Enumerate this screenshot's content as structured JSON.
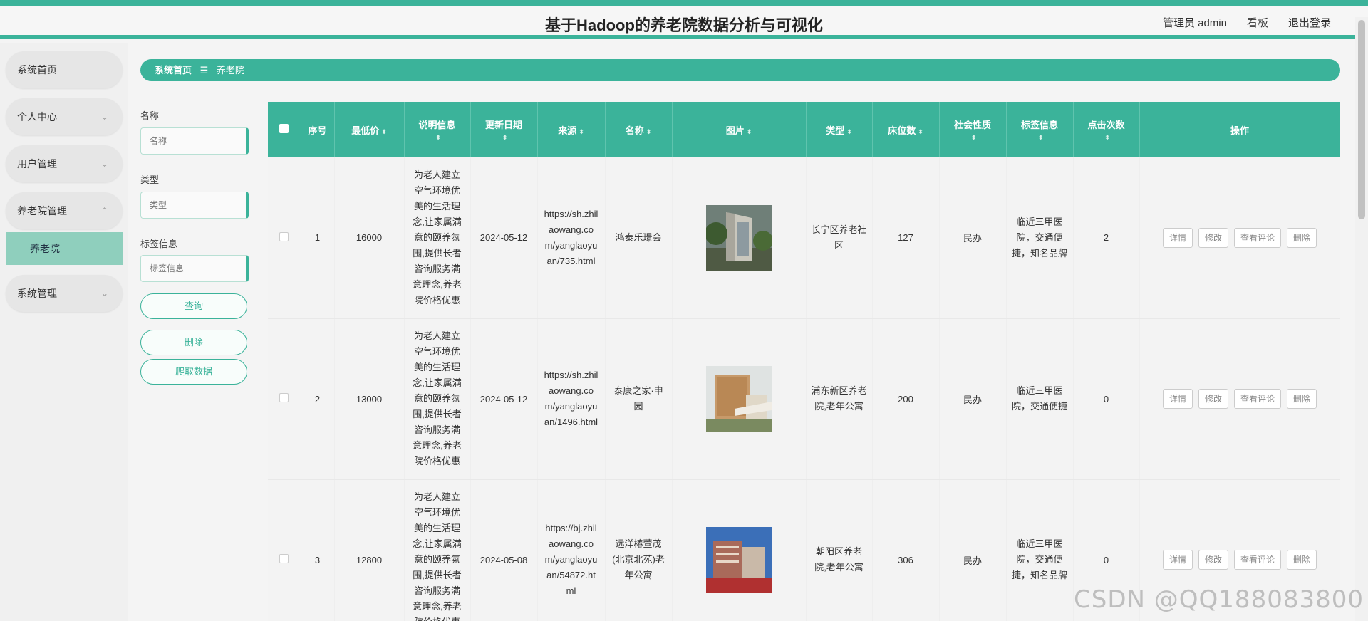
{
  "header": {
    "title": "基于Hadoop的养老院数据分析与可视化",
    "admin": "管理员 admin",
    "board": "看板",
    "logout": "退出登录"
  },
  "sidebar": {
    "items": [
      {
        "label": "系统首页"
      },
      {
        "label": "个人中心"
      },
      {
        "label": "用户管理"
      },
      {
        "label": "养老院管理"
      },
      {
        "label": "养老院"
      },
      {
        "label": "系统管理"
      }
    ]
  },
  "breadcrumb": {
    "home": "系统首页",
    "separator": "☰",
    "current": "养老院"
  },
  "filters": {
    "name_label": "名称",
    "name_placeholder": "名称",
    "type_label": "类型",
    "type_placeholder": "类型",
    "tag_label": "标签信息",
    "tag_placeholder": "标签信息",
    "query_button": "查询",
    "delete_button": "删除",
    "crawl_button": "爬取数据"
  },
  "table": {
    "columns": [
      "序号",
      "最低价",
      "说明信息",
      "更新日期",
      "来源",
      "名称",
      "图片",
      "类型",
      "床位数",
      "社会性质",
      "标签信息",
      "点击次数",
      "操作"
    ],
    "actions": [
      "详情",
      "修改",
      "查看评论",
      "删除"
    ],
    "rows": [
      {
        "index": "1",
        "price": "16000",
        "desc": "为老人建立空气环境优美的生活理念,让家属满意的颐养氛围,提供长者咨询服务满意理念,养老院价格优惠",
        "date": "2024-05-12",
        "source": "https://sh.zhilaowang.com/yanglaoyuan/735.html",
        "name": "鸿泰乐璟会",
        "type": "长宁区养老社区",
        "beds": "127",
        "nature": "民办",
        "tags": "临近三甲医院，交通便捷，知名品牌",
        "clicks": "2"
      },
      {
        "index": "2",
        "price": "13000",
        "desc": "为老人建立空气环境优美的生活理念,让家属满意的颐养氛围,提供长者咨询服务满意理念,养老院价格优惠",
        "date": "2024-05-12",
        "source": "https://sh.zhilaowang.com/yanglaoyuan/1496.html",
        "name": "泰康之家·申园",
        "type": "浦东新区养老院,老年公寓",
        "beds": "200",
        "nature": "民办",
        "tags": "临近三甲医院，交通便捷",
        "clicks": "0"
      },
      {
        "index": "3",
        "price": "12800",
        "desc": "为老人建立空气环境优美的生活理念,让家属满意的颐养氛围,提供长者咨询服务满意理念,养老院价格优惠",
        "date": "2024-05-08",
        "source": "https://bj.zhilaowang.com/yanglaoyuan/54872.html",
        "name": "远洋椿萱茂(北京北苑)老年公寓",
        "type": "朝阳区养老院,老年公寓",
        "beds": "306",
        "nature": "民办",
        "tags": "临近三甲医院，交通便捷，知名品牌",
        "clicks": "0"
      }
    ]
  },
  "watermark": "CSDN @QQ188083800"
}
